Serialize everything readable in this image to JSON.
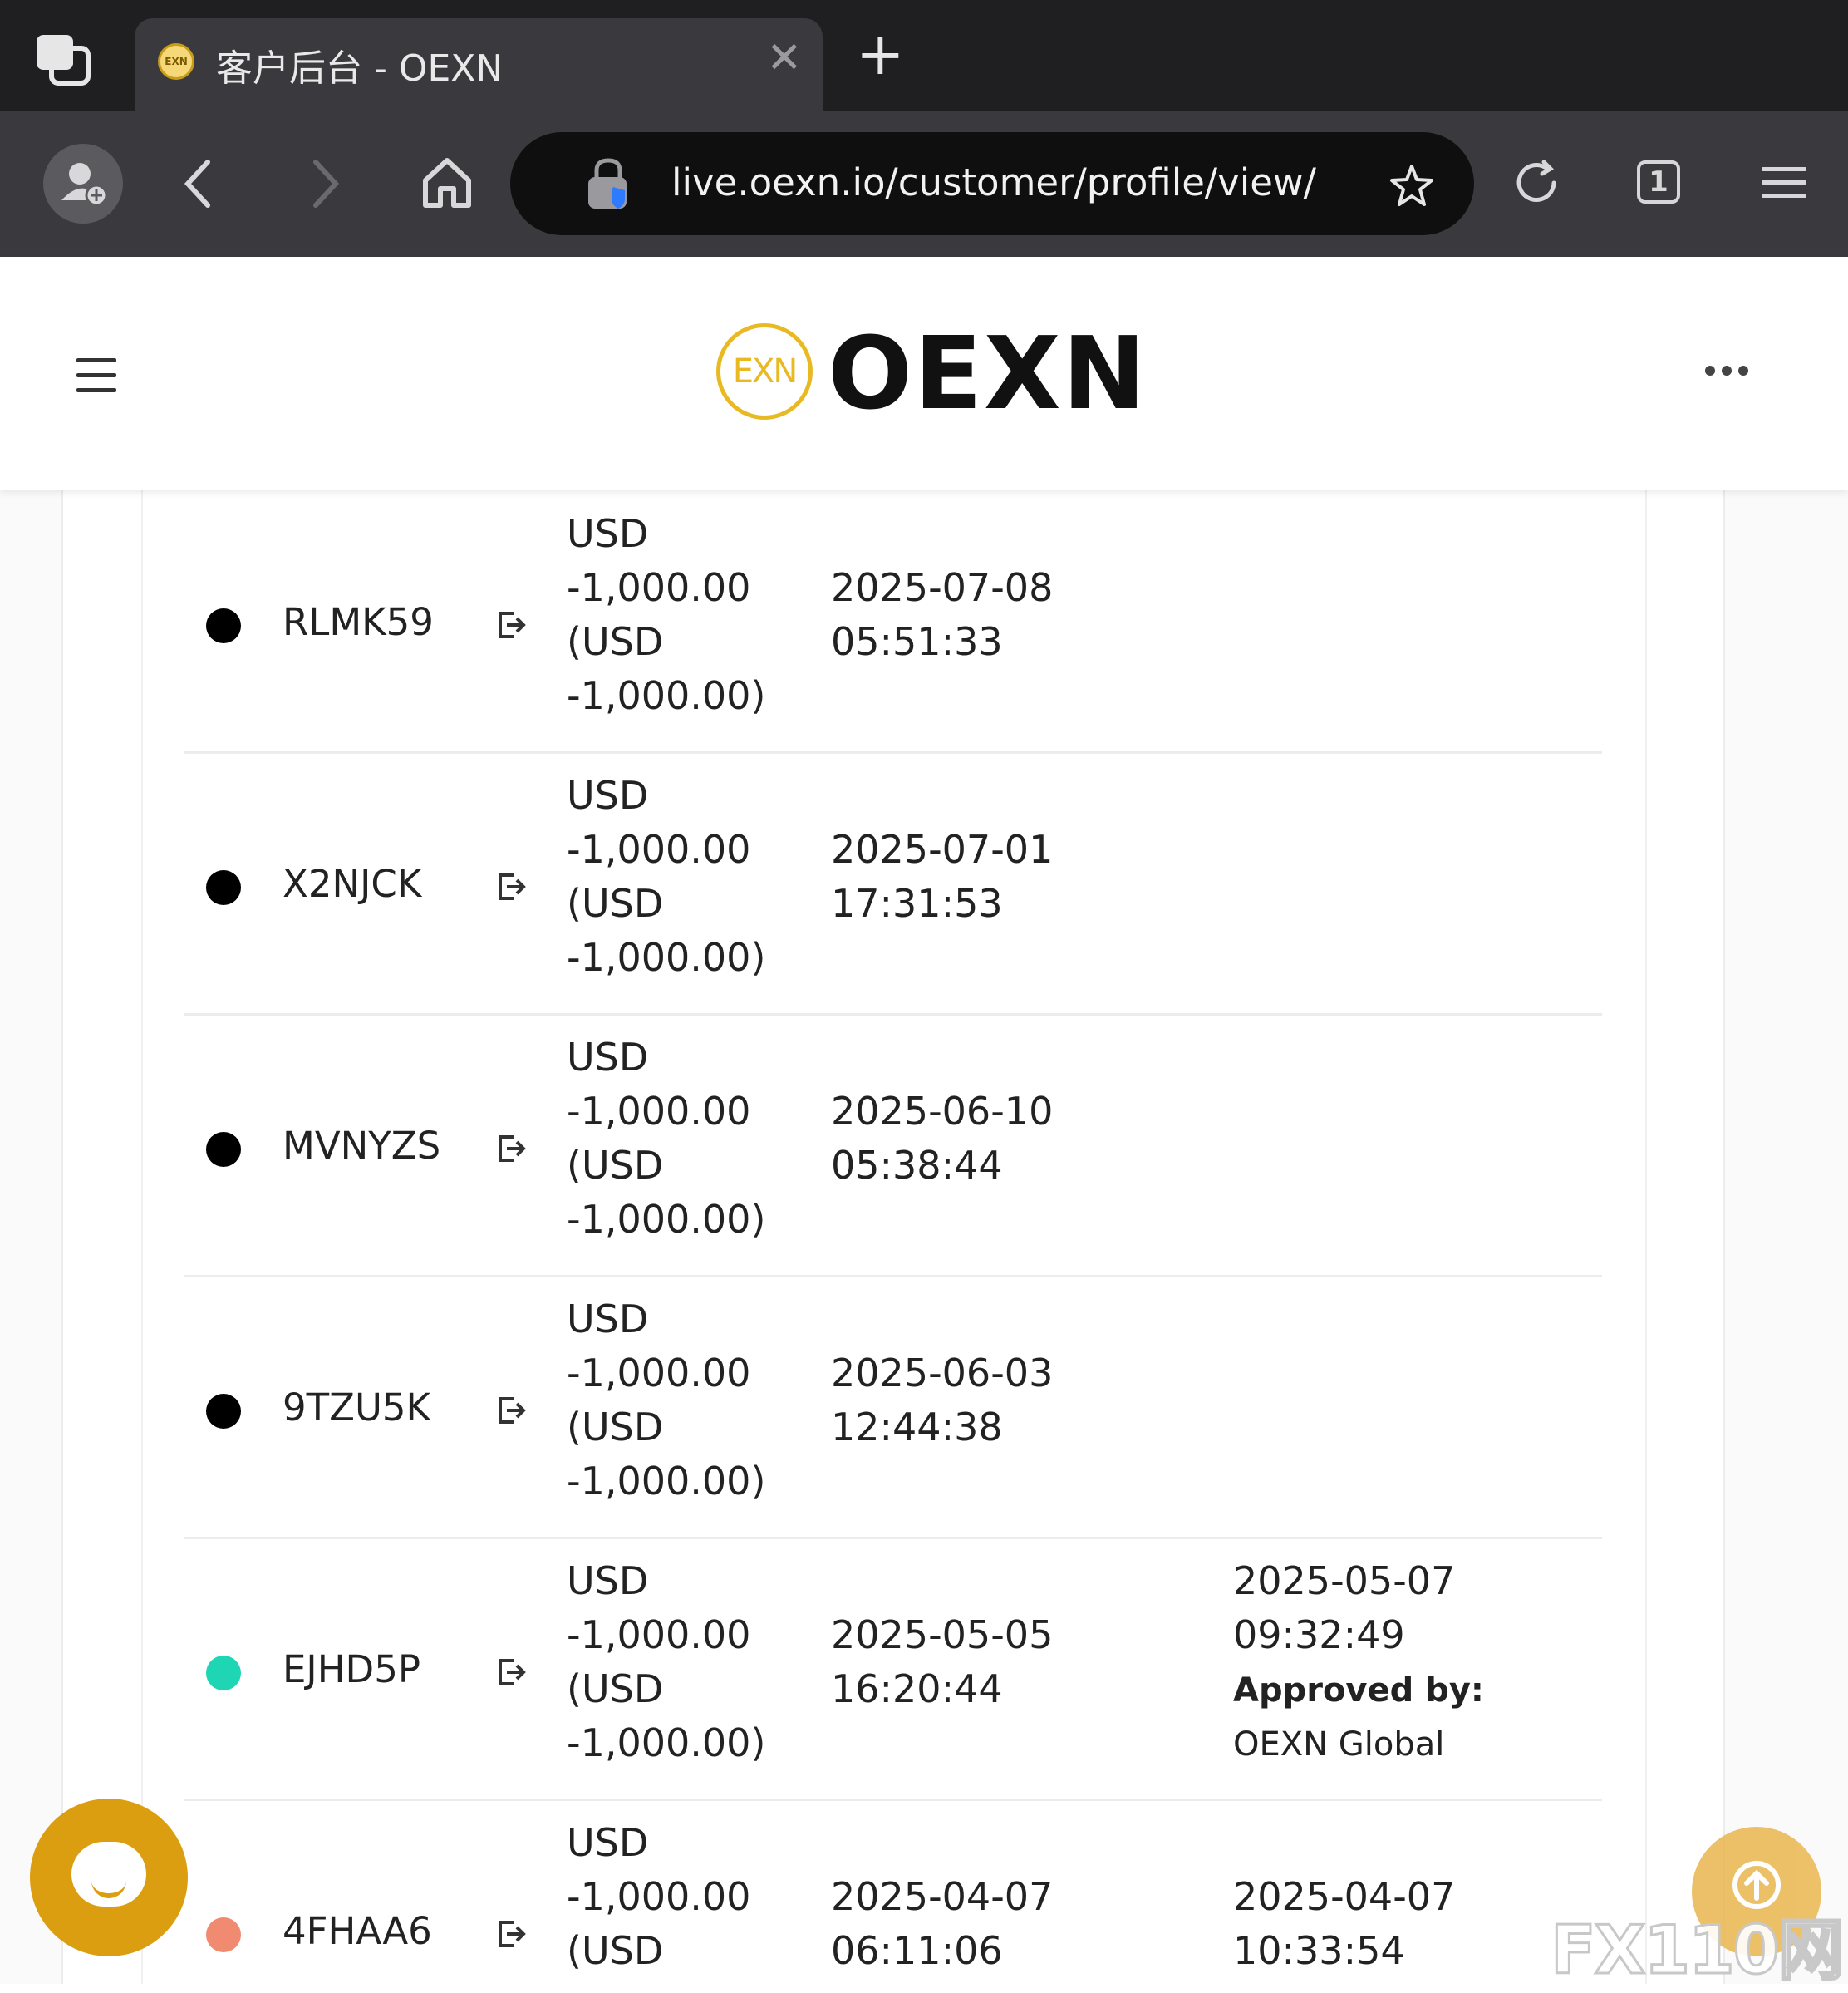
{
  "browser": {
    "tab_title": "客户后台 - OEXN",
    "favicon_text": "EXN",
    "tab_close": "✕",
    "new_tab": "+",
    "url": "live.oexn.io/customer/profile/view/",
    "tabs_count": "1"
  },
  "site": {
    "logo_mark_text": "EXN",
    "logo_text": "OEXN"
  },
  "transactions": [
    {
      "ticket": "RLMK59",
      "status_color": "#000000",
      "amount": "USD\n-1,000.00\n(USD\n-1,000.00)",
      "created": "2025-07-08\n05:51:33",
      "processed": "",
      "approved_label": "",
      "approved_value": ""
    },
    {
      "ticket": "X2NJCK",
      "status_color": "#000000",
      "amount": "USD\n-1,000.00\n(USD\n-1,000.00)",
      "created": "2025-07-01\n17:31:53",
      "processed": "",
      "approved_label": "",
      "approved_value": ""
    },
    {
      "ticket": "MVNYZS",
      "status_color": "#000000",
      "amount": "USD\n-1,000.00\n(USD\n-1,000.00)",
      "created": "2025-06-10\n05:38:44",
      "processed": "",
      "approved_label": "",
      "approved_value": ""
    },
    {
      "ticket": "9TZU5K",
      "status_color": "#000000",
      "amount": "USD\n-1,000.00\n(USD\n-1,000.00)",
      "created": "2025-06-03\n12:44:38",
      "processed": "",
      "approved_label": "",
      "approved_value": ""
    },
    {
      "ticket": "EJHD5P",
      "status_color": "#1ed6b4",
      "amount": "USD\n-1,000.00\n(USD\n-1,000.00)",
      "created": "2025-05-05\n16:20:44",
      "processed": "2025-05-07\n09:32:49",
      "approved_label": "Approved by:",
      "approved_value": " OEXN Global"
    },
    {
      "ticket": "4FHAA6",
      "status_color": "#f08a70",
      "amount": "USD\n-1,000.00\n(USD",
      "created": "2025-04-07\n06:11:06",
      "processed": "2025-04-07\n10:33:54",
      "approved_label": "",
      "approved_value": ""
    }
  ],
  "watermark": "FX110网",
  "colors": {
    "accent": "#dc9e11",
    "logo_gold": "#e8b923",
    "chrome_dark": "#1f1f22",
    "chrome_toolbar": "#3a3a3e"
  },
  "icons": [
    "tab-switcher-icon",
    "profile-add-icon",
    "back-icon",
    "forward-icon",
    "home-icon",
    "site-security-icon",
    "bookmark-star-icon",
    "reload-icon",
    "menu-icon",
    "hamburger-icon",
    "more-icon",
    "withdraw-out-icon",
    "chat-icon",
    "scroll-top-icon"
  ]
}
